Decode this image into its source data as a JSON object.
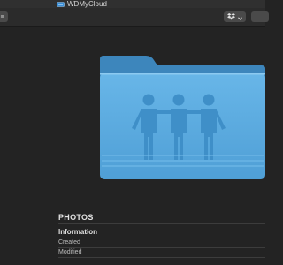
{
  "window": {
    "title": "WDMyCloud",
    "icon": "network-drive-icon"
  },
  "toolbar": {
    "sidebar_icon": "sidebar-toggle-icon",
    "dropbox_icon": "dropbox-icon",
    "dropbox_menu_icon": "chevron-down-icon"
  },
  "preview": {
    "item_name": "PHOTOS",
    "item_icon": "shared-folder-icon",
    "folder_color": "#5aabdf",
    "info": {
      "heading": "Information",
      "rows": [
        {
          "label": "Created"
        },
        {
          "label": "Modified"
        }
      ]
    }
  },
  "colors": {
    "background": "#232323",
    "toolbar": "#2b2b2b",
    "button": "#4a4a4a",
    "folder_blue": "#5aabdf",
    "folder_tab": "#3e86bd"
  }
}
